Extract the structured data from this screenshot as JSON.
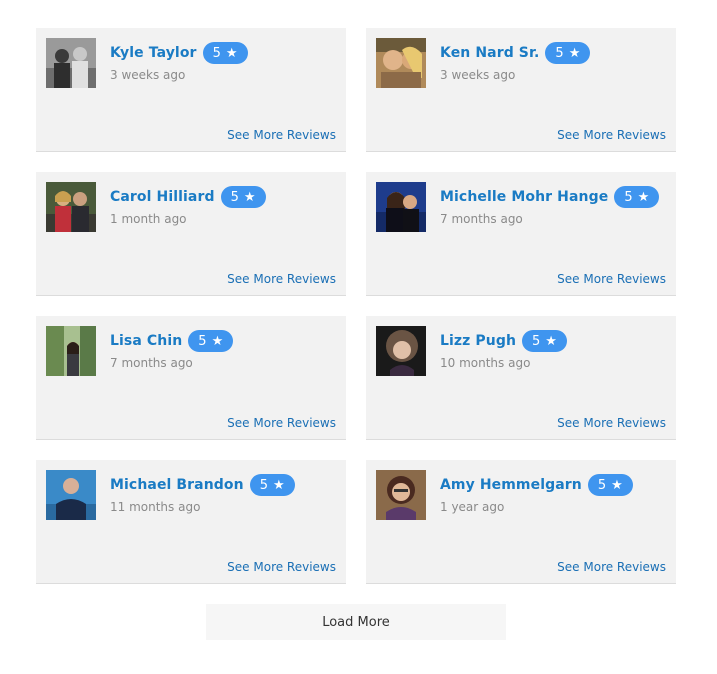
{
  "reviews": [
    {
      "name": "Kyle Taylor",
      "rating": "5",
      "time": "3 weeks ago",
      "link": "See More Reviews"
    },
    {
      "name": "Ken Nard Sr.",
      "rating": "5",
      "time": "3 weeks ago",
      "link": "See More Reviews"
    },
    {
      "name": "Carol Hilliard",
      "rating": "5",
      "time": "1 month ago",
      "link": "See More Reviews"
    },
    {
      "name": "Michelle Mohr Hange",
      "rating": "5",
      "time": "7 months ago",
      "link": "See More Reviews"
    },
    {
      "name": "Lisa Chin",
      "rating": "5",
      "time": "7 months ago",
      "link": "See More Reviews"
    },
    {
      "name": "Lizz Pugh",
      "rating": "5",
      "time": "10 months ago",
      "link": "See More Reviews"
    },
    {
      "name": "Michael Brandon",
      "rating": "5",
      "time": "11 months ago",
      "link": "See More Reviews"
    },
    {
      "name": "Amy Hemmelgarn",
      "rating": "5",
      "time": "1 year ago",
      "link": "See More Reviews"
    }
  ],
  "star_icon": "star-icon",
  "load_more_label": "Load More",
  "colors": {
    "name": "#1a7bc4",
    "badge": "#3f95ef",
    "link": "#1a6fb5",
    "card": "#f2f2f2"
  }
}
